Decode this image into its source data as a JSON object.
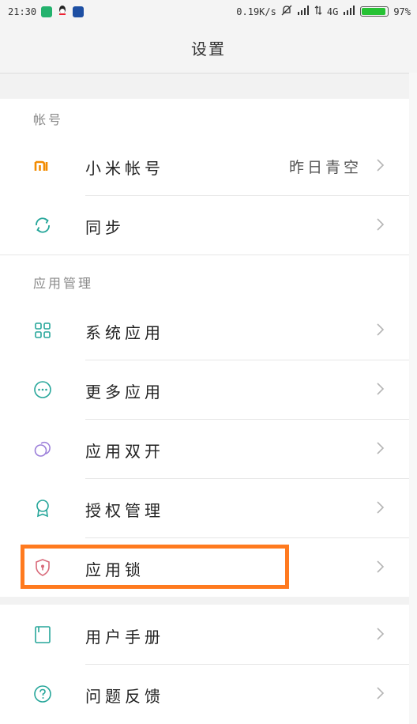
{
  "status_bar": {
    "time": "21:30",
    "speed": "0.19K/s",
    "network": "4G",
    "battery": "97%",
    "icons": [
      "notification-app-icon",
      "qq-icon",
      "app-icon",
      "mute-icon",
      "signal-icon",
      "data-arrows-icon",
      "battery-icon"
    ]
  },
  "header": {
    "title": "设置"
  },
  "sections": [
    {
      "label": "帐号",
      "items": [
        {
          "label": "小米帐号",
          "value": "昨日青空",
          "icon": "mi-logo-icon"
        },
        {
          "label": "同步",
          "icon": "sync-icon"
        }
      ]
    },
    {
      "label": "应用管理",
      "items": [
        {
          "label": "系统应用",
          "icon": "grid-apps-icon"
        },
        {
          "label": "更多应用",
          "icon": "more-dots-icon"
        },
        {
          "label": "应用双开",
          "icon": "dual-app-icon"
        },
        {
          "label": "授权管理",
          "icon": "badge-icon"
        },
        {
          "label": "应用锁",
          "icon": "shield-lock-icon",
          "highlighted": true
        }
      ]
    },
    {
      "label": "",
      "items": [
        {
          "label": "用户手册",
          "icon": "book-icon"
        },
        {
          "label": "问题反馈",
          "icon": "help-icon"
        }
      ]
    }
  ],
  "colors": {
    "accent": "#26a69a",
    "highlight": "#ff7a1f",
    "mi_brand": "#f28b00",
    "dual": "#9b7ed9",
    "lock": "#d96a7a"
  }
}
